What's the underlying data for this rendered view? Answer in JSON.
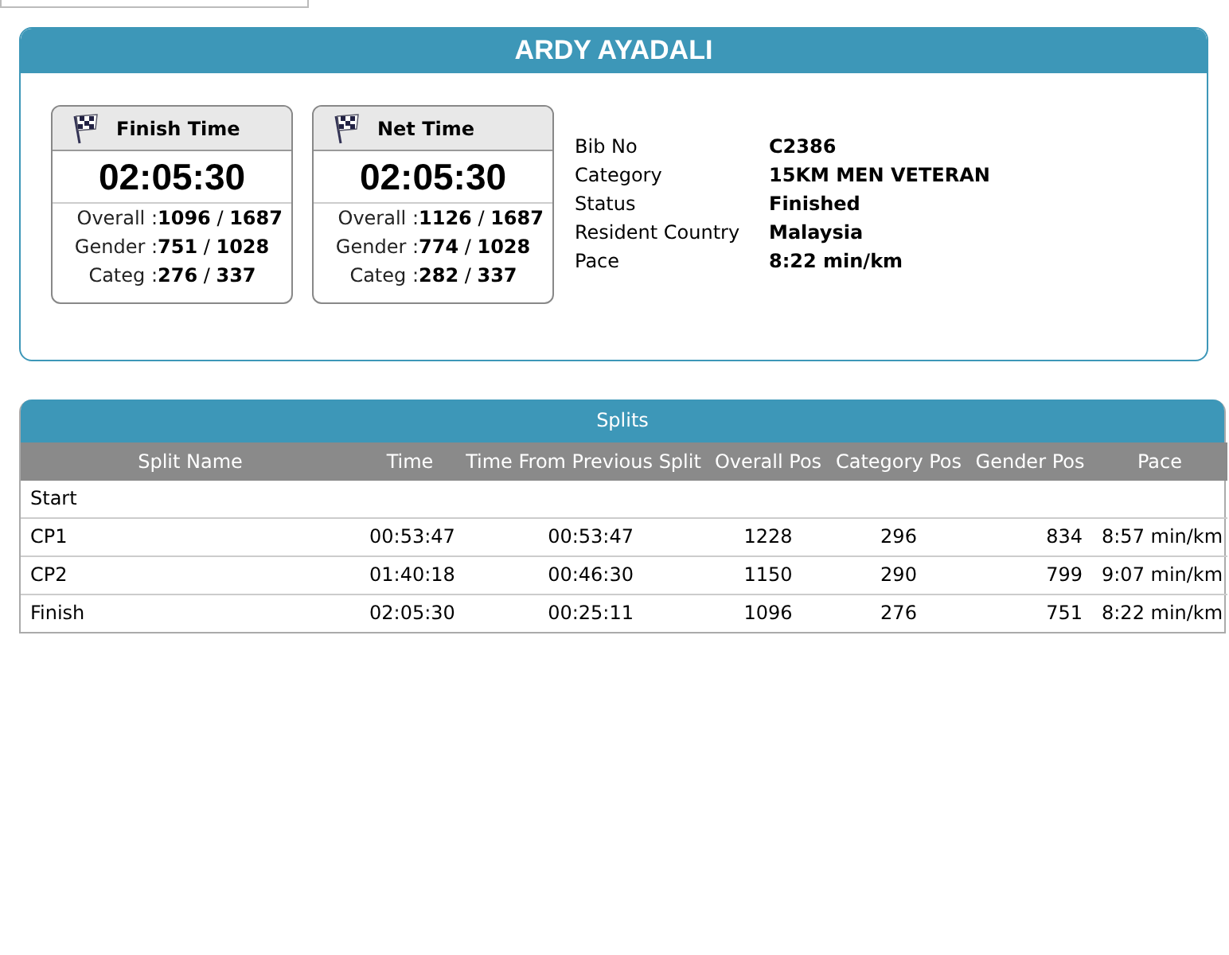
{
  "runner": {
    "name": "ARDY AYADALI"
  },
  "time_cards": [
    {
      "title": "Finish Time",
      "time": "02:05:30",
      "stats": [
        {
          "label": "Overall :",
          "value": "**1096** / **1687**"
        },
        {
          "label": "Gender :",
          "value": "**751** / **1028**"
        },
        {
          "label": "Categ :",
          "value": "**276** / **337**"
        }
      ]
    },
    {
      "title": "Net Time",
      "time": "02:05:30",
      "stats": [
        {
          "label": "Overall :",
          "value": "**1126** / **1687**"
        },
        {
          "label": "Gender :",
          "value": "**774** / **1028**"
        },
        {
          "label": "Categ :",
          "value": "**282** / **337**"
        }
      ]
    }
  ],
  "details": [
    {
      "label": "Bib No",
      "value": "C2386"
    },
    {
      "label": "Category",
      "value": "15KM MEN VETERAN"
    },
    {
      "label": "Status",
      "value": "Finished"
    },
    {
      "label": "Resident Country",
      "value": "Malaysia"
    },
    {
      "label": "Pace",
      "value": "8:22 min/km"
    }
  ],
  "splits": {
    "title": "Splits",
    "columns": [
      "Split Name",
      "Time",
      "Time From Previous Split",
      "Overall Pos",
      "Category Pos",
      "Gender Pos",
      "Pace"
    ],
    "rows": [
      [
        "Start"
      ],
      [
        "CP1",
        "00:53:47",
        "00:53:47",
        "1228",
        "296",
        "834",
        "8:57 min/km"
      ],
      [
        "CP2",
        "01:40:18",
        "00:46:30",
        "1150",
        "290",
        "799",
        "9:07 min/km"
      ],
      [
        "Finish",
        "02:05:30",
        "00:25:11",
        "1096",
        "276",
        "751",
        "8:22 min/km"
      ]
    ]
  }
}
